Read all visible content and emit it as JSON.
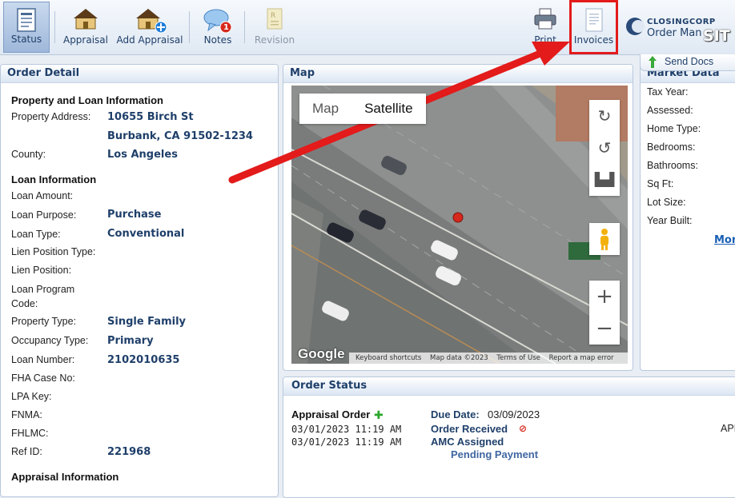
{
  "toolbar": {
    "status": "Status",
    "appraisal": "Appraisal",
    "add_appraisal": "Add Appraisal",
    "notes": "Notes",
    "notes_badge": "1",
    "revision": "Revision",
    "print": "Print",
    "invoices": "Invoices"
  },
  "brand": {
    "company": "CLOSINGCORP",
    "product": "Order Man",
    "overlay": "SIT"
  },
  "send_docs": "Send Docs",
  "order_detail": {
    "title": "Order Detail",
    "property_section": "Property and Loan Information",
    "property_address_label": "Property Address:",
    "address_line1": "10655 Birch St",
    "address_line2": "Burbank, CA 91502-1234",
    "county_label": "County:",
    "county": "Los Angeles",
    "loan_section": "Loan Information",
    "loan_amount_label": "Loan Amount:",
    "loan_purpose_label": "Loan Purpose:",
    "loan_purpose": "Purchase",
    "loan_type_label": "Loan Type:",
    "loan_type": "Conventional",
    "lien_position_type_label": "Lien Position Type:",
    "lien_position_label": "Lien Position:",
    "loan_program_label_1": "Loan Program",
    "loan_program_label_2": "Code:",
    "property_type_label": "Property Type:",
    "property_type": "Single Family",
    "occupancy_type_label": "Occupancy Type:",
    "occupancy_type": "Primary",
    "loan_number_label": "Loan Number:",
    "loan_number": "2102010635",
    "fha_label": "FHA Case No:",
    "lpa_label": "LPA Key:",
    "fnma_label": "FNMA:",
    "fhlmc_label": "FHLMC:",
    "ref_id_label": "Ref ID:",
    "ref_id": "221968",
    "appraisal_section": "Appraisal Information"
  },
  "map": {
    "title": "Map",
    "toggle_map": "Map",
    "toggle_satellite": "Satellite",
    "google": "Google",
    "footer": [
      "Keyboard shortcuts",
      "Map data ©2023",
      "Terms of Use",
      "Report a map error"
    ]
  },
  "market_data": {
    "title": "Market Data",
    "labels": [
      "Tax Year:",
      "Assessed:",
      "Home Type:",
      "Bedrooms:",
      "Bathrooms:",
      "Sq Ft:",
      "Lot Size:",
      "Year Built:"
    ],
    "more": "Mor"
  },
  "order_status": {
    "title": "Order Status",
    "appraisal_order": "Appraisal Order",
    "due_date_label": "Due Date:",
    "due_date": "03/09/2023",
    "time1": "03/01/2023 11:19 AM",
    "time2": "03/01/2023 11:19 AM",
    "status1": "Order Received",
    "status2": "AMC Assigned",
    "status3": "Pending Payment",
    "right_clip": "API"
  }
}
